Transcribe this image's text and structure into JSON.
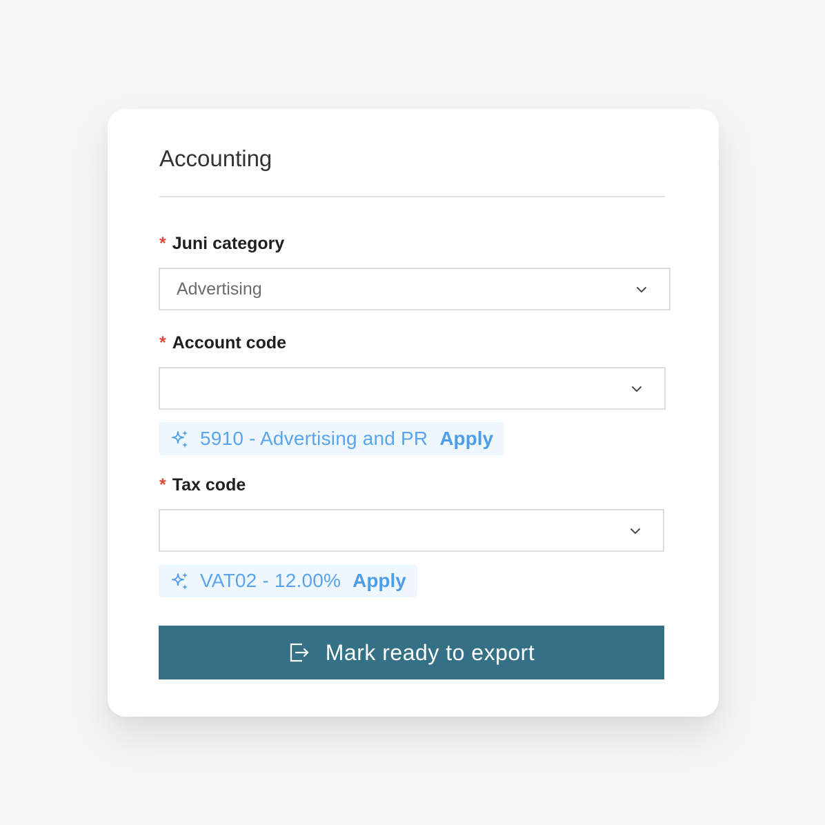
{
  "panel": {
    "title": "Accounting"
  },
  "fields": {
    "category": {
      "required_mark": "*",
      "label": "Juni category",
      "value": "Advertising",
      "icon": "chevron-down-icon"
    },
    "account_code": {
      "required_mark": "*",
      "label": "Account code",
      "value": "",
      "icon": "chevron-down-icon",
      "suggestion": {
        "icon": "sparkle-icon",
        "text": "5910 - Advertising and PR",
        "action": "Apply"
      }
    },
    "tax_code": {
      "required_mark": "*",
      "label": "Tax code",
      "value": "",
      "icon": "chevron-down-icon",
      "suggestion": {
        "icon": "sparkle-icon",
        "text": "VAT02 - 12.00%",
        "action": "Apply"
      }
    }
  },
  "export_button": {
    "icon": "export-icon",
    "label": "Mark ready to export"
  },
  "colors": {
    "background": "#f6f6f6",
    "card": "#ffffff",
    "required": "#e0473a",
    "suggestion_bg": "#eef6fe",
    "suggestion_text": "#5ba4ee",
    "primary_button": "#347186"
  }
}
